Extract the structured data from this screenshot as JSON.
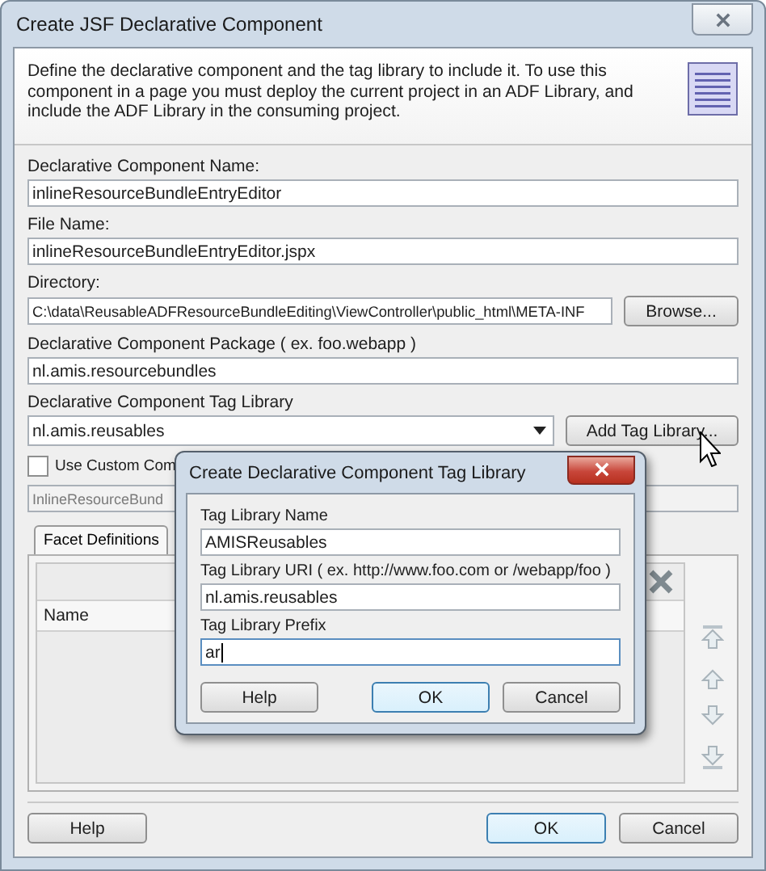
{
  "window": {
    "title": "Create JSF Declarative Component"
  },
  "header": {
    "description": "Define the declarative component and the tag library to include it.  To use this component in a page you must deploy the current project in an ADF Library, and include the ADF Library in the consuming project."
  },
  "fields": [
    {
      "kind": "text",
      "label": "Declarative Component Name:",
      "value": "inlineResourceBundleEntryEditor",
      "disabled": false
    },
    {
      "kind": "text",
      "label": "File Name:",
      "value": "inlineResourceBundleEntryEditor.jspx",
      "disabled": false
    },
    {
      "kind": "browse",
      "label": "Directory:",
      "value": "C:\\data\\ReusableADFResourceBundleEditing\\ViewController\\public_html\\META-INF",
      "button": "Browse...",
      "disabled": false
    },
    {
      "kind": "text",
      "label": "Declarative Component Package ( ex. foo.webapp )",
      "value": "nl.amis.resourcebundles",
      "disabled": false
    },
    {
      "kind": "select",
      "label": "Declarative Component Tag Library",
      "value": "nl.amis.reusables",
      "button": "Add Tag Library...",
      "disabled": false
    },
    {
      "kind": "checkbox",
      "label": "Use Custom Com",
      "checked": false
    },
    {
      "kind": "text",
      "value": "InlineResourceBund",
      "disabled": true
    }
  ],
  "tabs": [
    {
      "label": "Facet Definitions",
      "selected": true
    }
  ],
  "table": {
    "columns": [
      "Name"
    ]
  },
  "buttons": [
    {
      "label": "Help",
      "default": false
    },
    {
      "label": "OK",
      "default": true
    },
    {
      "label": "Cancel",
      "default": false
    }
  ],
  "subdialog": {
    "title": "Create Declarative Component Tag Library",
    "fields": [
      {
        "label": "Tag Library Name",
        "value": "AMISReusables",
        "focused": false
      },
      {
        "label": "Tag Library URI ( ex. http://www.foo.com or /webapp/foo )",
        "value": "nl.amis.reusables",
        "focused": false
      },
      {
        "label": "Tag Library Prefix",
        "value": "ar",
        "focused": true
      }
    ],
    "buttons": [
      {
        "label": "Help",
        "default": false
      },
      {
        "label": "OK",
        "default": true
      },
      {
        "label": "Cancel",
        "default": false
      }
    ]
  }
}
